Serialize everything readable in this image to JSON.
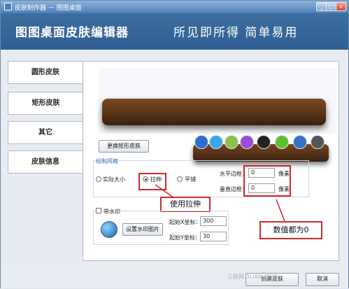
{
  "window": {
    "title": "皮肤制作器 － 图图桌面"
  },
  "banner": {
    "title": "图图桌面皮肤编辑器",
    "slogan": "所见即所得 简单易用"
  },
  "sidebar": {
    "items": [
      {
        "label": "圆形皮肤"
      },
      {
        "label": "矩形皮肤"
      },
      {
        "label": "其它"
      },
      {
        "label": "皮肤信息"
      }
    ]
  },
  "main": {
    "replace_skin_button": "更换矩形皮肤",
    "style_group_label": "绘制风格",
    "radio_options": {
      "actual": "实际大小",
      "stretch": "拉伸",
      "tile": "平铺"
    },
    "horizontal_label": "水平边框：",
    "horizontal_value": "0",
    "horizontal_unit": "像素",
    "vertical_label": "垂直边框：",
    "vertical_value": "0",
    "vertical_unit": "像素",
    "watermark_checkbox": "带水印",
    "watermark_button": "设置水印图片",
    "x_label": "起始X坐标：",
    "x_value": "300",
    "y_label": "起始Y坐标：",
    "y_value": "30",
    "callout_stretch": "使用拉伸",
    "callout_values": "数值都为0"
  },
  "footer": {
    "create_button": "创建皮肤",
    "cancel_button": "取消",
    "watermark": "三联网 3LIAN.COM"
  },
  "colors": {
    "banner": "#2f5f92",
    "accent": "#1f66b2",
    "highlight": "#d12828"
  }
}
